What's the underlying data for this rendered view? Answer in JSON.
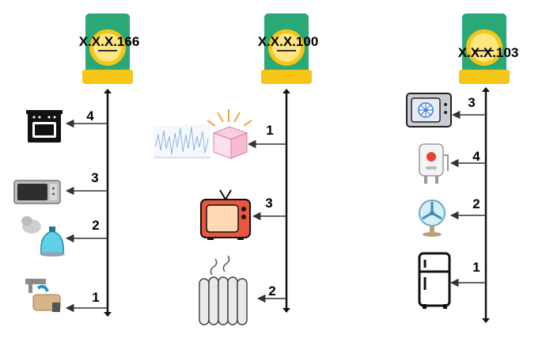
{
  "meters": [
    {
      "label": "X.X.X.166",
      "appliances": [
        {
          "icon": "oven-icon",
          "number": "4"
        },
        {
          "icon": "microwave-icon",
          "number": "3"
        },
        {
          "icon": "kettle-icon",
          "number": "2"
        },
        {
          "icon": "water-filter-icon",
          "number": "1"
        }
      ]
    },
    {
      "label": "X.X.X.100",
      "appliances": [
        {
          "icon": "data-package-icon",
          "number": "1"
        },
        {
          "icon": "television-icon",
          "number": "3"
        },
        {
          "icon": "radiator-heater-icon",
          "number": "2"
        }
      ]
    },
    {
      "label": "X.X.X.103",
      "appliances": [
        {
          "icon": "air-conditioner-icon",
          "number": "3"
        },
        {
          "icon": "water-heater-icon",
          "number": "4"
        },
        {
          "icon": "fan-icon",
          "number": "2"
        },
        {
          "icon": "refrigerator-icon",
          "number": "1"
        }
      ]
    }
  ],
  "colors": {
    "meter_body": "#2aa876",
    "meter_accent": "#f5c518",
    "line": "#111111",
    "arrow": "#333333"
  }
}
